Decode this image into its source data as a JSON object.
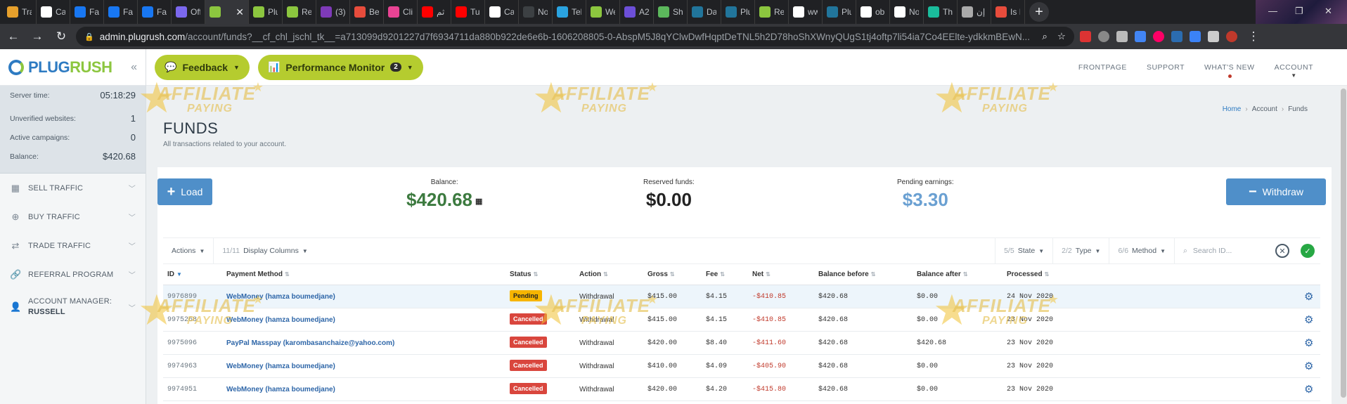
{
  "browser": {
    "tabs": [
      {
        "label": "Tra",
        "color": "#e6a02c"
      },
      {
        "label": "Cal",
        "color": "#ffffff"
      },
      {
        "label": "Fac",
        "color": "#1877f2"
      },
      {
        "label": "Fac",
        "color": "#1877f2"
      },
      {
        "label": "Fac",
        "color": "#1877f2"
      },
      {
        "label": "Off",
        "color": "#7b68ee"
      },
      {
        "label": "",
        "color": "#8cc63f"
      },
      {
        "label": "Plu",
        "color": "#8cc63f"
      },
      {
        "label": "Re",
        "color": "#8cc63f"
      },
      {
        "label": "(3)",
        "color": "#7e3ab8"
      },
      {
        "label": "Be",
        "color": "#e74c3c"
      },
      {
        "label": "Cli",
        "color": "#e84393"
      },
      {
        "label": "ثم",
        "color": "#ff0000"
      },
      {
        "label": "Tu",
        "color": "#ff0000"
      },
      {
        "label": "Ca",
        "color": "#ffffff"
      },
      {
        "label": "Nouve",
        "color": "#3c4043"
      },
      {
        "label": "Tel",
        "color": "#2aa3e0"
      },
      {
        "label": "We",
        "color": "#8cc63f"
      },
      {
        "label": "A2",
        "color": "#6c4fd8"
      },
      {
        "label": "Sh",
        "color": "#5cb85c"
      },
      {
        "label": "Da",
        "color": "#21759b"
      },
      {
        "label": "Plu",
        "color": "#21759b"
      },
      {
        "label": "Re",
        "color": "#8cc63f"
      },
      {
        "label": "ww",
        "color": "#ffffff"
      },
      {
        "label": "Plu",
        "color": "#21759b"
      },
      {
        "label": "ob",
        "color": "#ffffff"
      },
      {
        "label": "No",
        "color": "#ffffff"
      },
      {
        "label": "Th",
        "color": "#1abc9c"
      },
      {
        "label": "إن",
        "color": "#aaaaaa"
      },
      {
        "label": "Is I",
        "color": "#e74c3c"
      }
    ],
    "url_host": "admin.plugrush.com",
    "url_path": "/account/funds?__cf_chl_jschl_tk__=a713099d9201227d7f6934711da880b922de6e6b-1606208805-0-AbspM5J8qYClwDwfHqptDeTNL5h2D78hoShXWnyQUgS1tj4oftp7li54ia7Co4EElte-ydkkmBEwN..."
  },
  "sidebar": {
    "logo_a": "PLUG",
    "logo_b": "RUSH",
    "server_time_label": "Server time:",
    "server_time": "05:18:29",
    "unverified_label": "Unverified websites:",
    "unverified": "1",
    "active_label": "Active campaigns:",
    "active": "0",
    "balance_label": "Balance:",
    "balance": "$420.68",
    "menu": [
      {
        "label": "Sell Traffic"
      },
      {
        "label": "Buy Traffic"
      },
      {
        "label": "Trade Traffic"
      },
      {
        "label": "Referral Program"
      }
    ],
    "manager_label": "Account Manager:",
    "manager_name": "Russell"
  },
  "topnav": {
    "feedback": "Feedback",
    "performance": "Performance Monitor",
    "performance_badge": "2",
    "links": [
      "FRONTPAGE",
      "SUPPORT",
      "WHAT'S NEW",
      "ACCOUNT"
    ]
  },
  "breadcrumb": {
    "home": "Home",
    "account": "Account",
    "current": "Funds"
  },
  "page": {
    "title": "FUNDS",
    "subtitle": "All transactions related to your account."
  },
  "actions": {
    "load": "Load",
    "withdraw": "Withdraw"
  },
  "stats": {
    "balance_label": "Balance:",
    "balance": "$420.68",
    "reserved_label": "Reserved funds:",
    "reserved": "$0.00",
    "pending_label": "Pending earnings:",
    "pending": "$3.30"
  },
  "toolbar": {
    "actions": "Actions",
    "columns_count": "11/11",
    "columns": "Display Columns",
    "state_count": "5/5",
    "state": "State",
    "type_count": "2/2",
    "type": "Type",
    "method_count": "6/6",
    "method": "Method",
    "search_placeholder": "Search ID..."
  },
  "table": {
    "headers": [
      "ID",
      "Payment Method",
      "Status",
      "Action",
      "Gross",
      "Fee",
      "Net",
      "Balance before",
      "Balance after",
      "Processed"
    ],
    "rows": [
      {
        "id": "9976899",
        "method": "WebMoney (hamza boumedjane)",
        "status": "Pending",
        "action": "Withdrawal",
        "gross": "$415.00",
        "fee": "$4.15",
        "net": "-$410.85",
        "before": "$420.68",
        "after": "$0.00",
        "processed": "24 Nov 2020"
      },
      {
        "id": "9975268",
        "method": "WebMoney (hamza boumedjane)",
        "status": "Cancelled",
        "action": "Withdrawal",
        "gross": "$415.00",
        "fee": "$4.15",
        "net": "-$410.85",
        "before": "$420.68",
        "after": "$0.00",
        "processed": "23 Nov 2020"
      },
      {
        "id": "9975096",
        "method": "PayPal Masspay (karombasanchaize@yahoo.com)",
        "status": "Cancelled",
        "action": "Withdrawal",
        "gross": "$420.00",
        "fee": "$8.40",
        "net": "-$411.60",
        "before": "$420.68",
        "after": "$420.68",
        "processed": "23 Nov 2020"
      },
      {
        "id": "9974963",
        "method": "WebMoney (hamza boumedjane)",
        "status": "Cancelled",
        "action": "Withdrawal",
        "gross": "$410.00",
        "fee": "$4.09",
        "net": "-$405.90",
        "before": "$420.68",
        "after": "$0.00",
        "processed": "23 Nov 2020"
      },
      {
        "id": "9974951",
        "method": "WebMoney (hamza boumedjane)",
        "status": "Cancelled",
        "action": "Withdrawal",
        "gross": "$420.00",
        "fee": "$4.20",
        "net": "-$415.80",
        "before": "$420.68",
        "after": "$0.00",
        "processed": "23 Nov 2020"
      }
    ]
  },
  "watermark": {
    "line1": "AFFILIATE",
    "line2": "PAYING"
  }
}
